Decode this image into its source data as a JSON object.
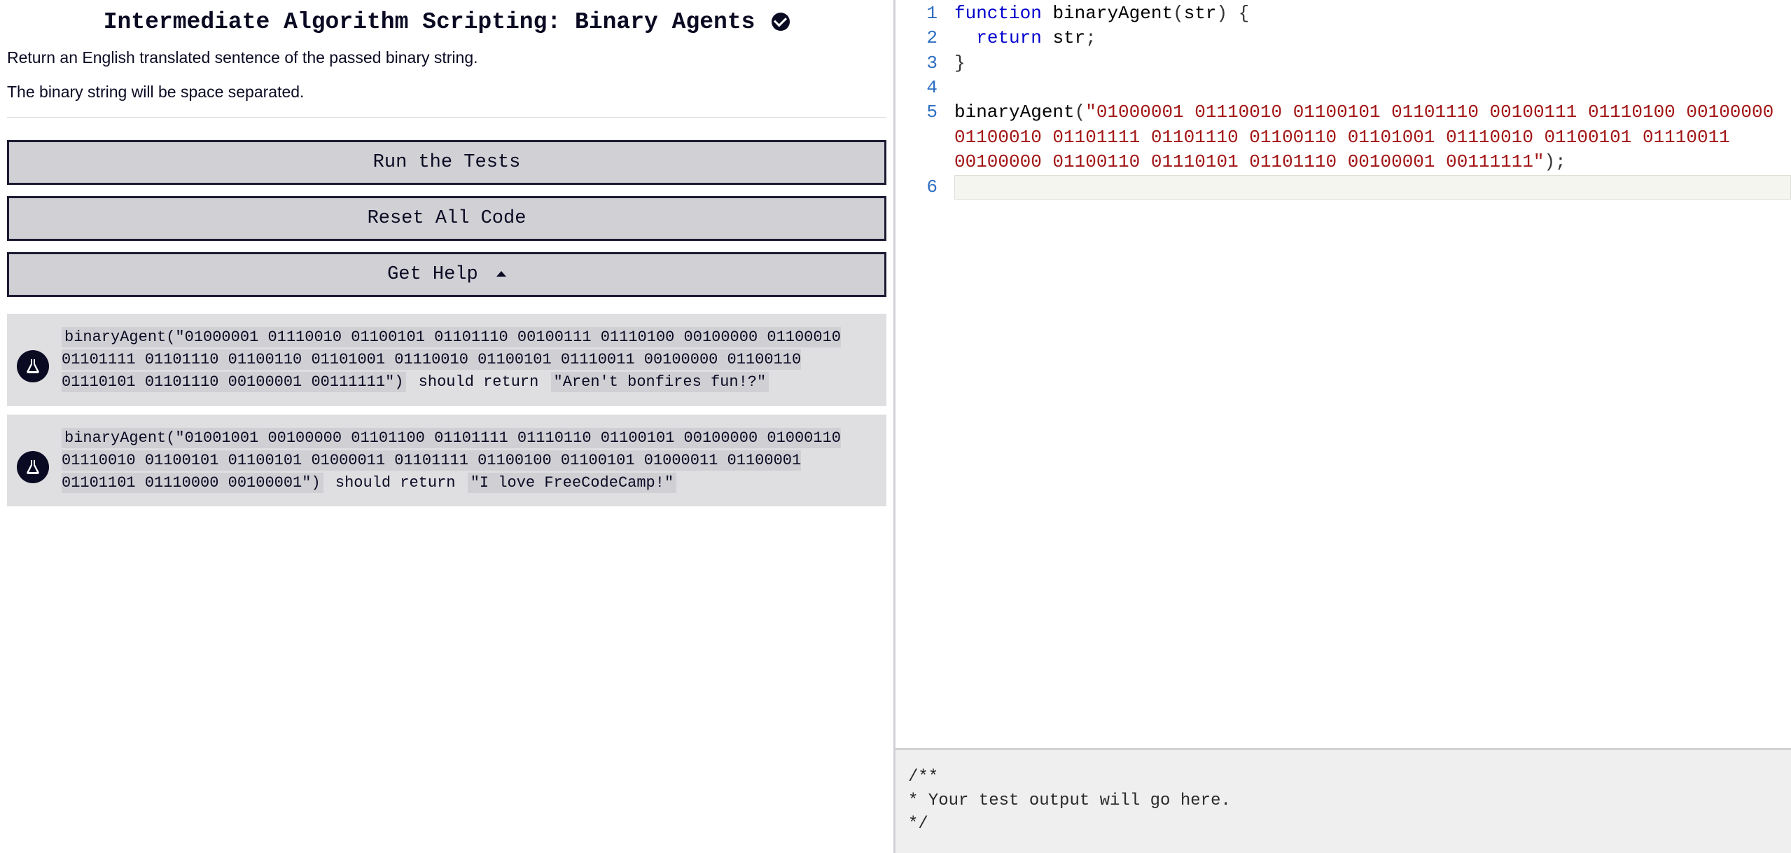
{
  "challenge": {
    "title_prefix": "Intermediate Algorithm Scripting: Binary Agents",
    "completed": true,
    "description": [
      "Return an English translated sentence of the passed binary string.",
      "The binary string will be space separated."
    ]
  },
  "buttons": {
    "run": "Run the Tests",
    "reset": "Reset All Code",
    "help": "Get Help"
  },
  "tests": [
    {
      "code": "binaryAgent(\"01000001 01110010 01100101 01101110 00100111 01110100 00100000 01100010 01101111 01101110 01100110 01101001 01110010 01100101 01110011 00100000 01100110 01110101 01101110 00100001 00111111\")",
      "mid": " should return ",
      "expect": "\"Aren't bonfires fun!?\""
    },
    {
      "code": "binaryAgent(\"01001001 00100000 01101100 01101111 01110110 01100101 00100000 01000110 01110010 01100101 01100101 01000011 01101111 01100100 01100101 01000011 01100001 01101101 01110000 00100001\")",
      "mid": " should return ",
      "expect": "\"I love FreeCodeCamp!\""
    }
  ],
  "editor": {
    "string_arg": "\"01000001 01110010 01100101 01101110 00100111 01110100 00100000 01100010 01101111 01101110 01100110 01101001 01110010 01100101 01110011 00100000 01100110 01110101 01101110 00100001 00111111\"",
    "line_numbers": [
      "1",
      "2",
      "3",
      "4",
      "5",
      "6"
    ],
    "tokens": {
      "kw_function": "function",
      "fn_name": "binaryAgent",
      "param": "str",
      "kw_return": "return",
      "ret_expr": "str",
      "open_brace": "{",
      "close_brace": "}",
      "call_name": "binaryAgent",
      "semicolon": ";",
      "open_paren": "(",
      "close_paren": ")"
    }
  },
  "output": {
    "text": "/**\n* Your test output will go here.\n*/"
  }
}
